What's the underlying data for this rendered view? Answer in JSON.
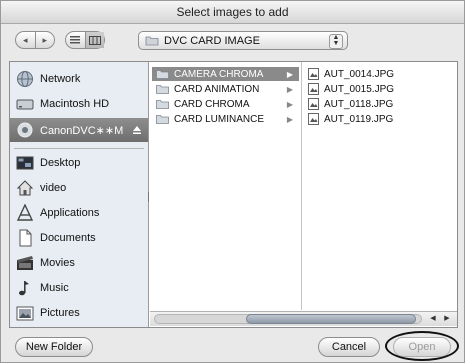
{
  "dialog": {
    "title": "Select images to add"
  },
  "toolbar": {
    "back_arrow": "◂",
    "forward_arrow": "▸",
    "location": "DVC CARD IMAGE"
  },
  "sidebar": {
    "devices": [
      {
        "label": "Network",
        "icon": "network-globe-icon"
      },
      {
        "label": "Macintosh HD",
        "icon": "hard-drive-icon"
      },
      {
        "label": "CanonDVC∗∗M",
        "icon": "camera-disk-icon",
        "selected": true
      }
    ],
    "places": [
      {
        "label": "Desktop",
        "icon": "desktop-icon"
      },
      {
        "label": "video",
        "icon": "home-folder-icon"
      },
      {
        "label": "Applications",
        "icon": "applications-icon"
      },
      {
        "label": "Documents",
        "icon": "documents-icon"
      },
      {
        "label": "Movies",
        "icon": "movies-icon"
      },
      {
        "label": "Music",
        "icon": "music-icon"
      },
      {
        "label": "Pictures",
        "icon": "pictures-icon"
      }
    ]
  },
  "browser": {
    "folders": [
      {
        "label": "CAMERA CHROMA",
        "selected": true
      },
      {
        "label": "CARD ANIMATION",
        "selected": false
      },
      {
        "label": "CARD CHROMA",
        "selected": false
      },
      {
        "label": "CARD LUMINANCE",
        "selected": false
      }
    ],
    "files": [
      {
        "label": "AUT_0014.JPG"
      },
      {
        "label": "AUT_0015.JPG"
      },
      {
        "label": "AUT_0118.JPG"
      },
      {
        "label": "AUT_0119.JPG"
      }
    ]
  },
  "buttons": {
    "new_folder": "New Folder",
    "cancel": "Cancel",
    "open": "Open"
  },
  "colors": {
    "selection": "#8a8a8a",
    "sidebar_bg": "#e8edf3"
  }
}
